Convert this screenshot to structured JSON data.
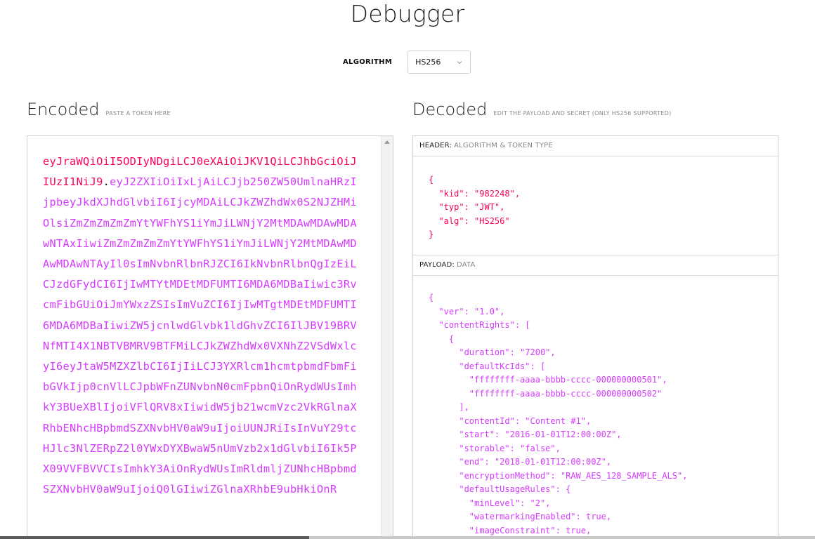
{
  "page": {
    "title": "Debugger"
  },
  "algorithm": {
    "label": "ALGORITHM",
    "value": "HS256"
  },
  "encoded": {
    "title": "Encoded",
    "subtitle": "PASTE A TOKEN HERE",
    "header_part": "eyJraWQiOiI5ODIyNDgiLCJ0eXAiOiJKV1QiLCJhbGciOiJIUzI1NiJ9",
    "dot": ".",
    "payload_part": "eyJ2ZXIiOiIxLjAiLCJjb250ZW50UmlnaHRzIjpbeyJkdXJhdGlvbiI6IjcyMDAiLCJkZWZhdWx0S2NJZHMiOlsiZmZmZmZmZmYtYWFhYS1iYmJiLWNjY2MtMDAwMDAwMDAwNTAxIiwiZmZmZmZmZmYtYWFhYS1iYmJiLWNjY2MtMDAwMDAwMDAwNTAyIl0sImNvbnRlbnRJZCI6IkNvbnRlbnQgIzEiLCJzdGFydCI6IjIwMTYtMDEtMDFUMTI6MDA6MDBaIiwic3RvcmFibGUiOiJmYWxzZSIsImVuZCI6IjIwMTgtMDEtMDFUMTI6MDA6MDBaIiwiZW5jcnlwdGlvbk1ldGhvZCI6IlJBV19BRVNfMTI4X1NBTVBMRV9BTFMiLCJkZWZhdWx0VXNhZ2VSdWxlcyI6eyJtaW5MZXZlbCI6IjIiLCJ3YXRlcm1hcmtpbmdFbmFibGVkIjp0cnVlLCJpbWFnZUNvbnN0cmFpbnQiOnRydWUsImhkY3BUeXBlIjoiVFlQRV8xIiwidW5jb21wcmVzc2VkRGlnaXRhbENhcHBpbmdSZXNvbHV0aW9uIjoiUUNJRiIsInVuY29tcHJlc3NlZERpZ2l0YWxDYXBwaW5nUmVzb2x1dGlvbiI6Ik5PX09VVFBVVCIsImhkY3AiOnRydWUsImRldmljZUNhcHBpbmdSZXNvbHV0aW9uIjoiQ0lGIiwiZGlnaXRhbE9ubHkiOnR"
  },
  "decoded": {
    "title": "Decoded",
    "subtitle": "EDIT THE PAYLOAD AND SECRET (ONLY HS256 SUPPORTED)",
    "header": {
      "label": "HEADER:",
      "sublabel": "ALGORITHM & TOKEN TYPE",
      "code": "{\n  \"kid\": \"982248\",\n  \"typ\": \"JWT\",\n  \"alg\": \"HS256\"\n}"
    },
    "payload": {
      "label": "PAYLOAD:",
      "sublabel": "DATA",
      "code": "{\n  \"ver\": \"1.0\",\n  \"contentRights\": [\n    {\n      \"duration\": \"7200\",\n      \"defaultKcIds\": [\n        \"ffffffff-aaaa-bbbb-cccc-000000000501\",\n        \"ffffffff-aaaa-bbbb-cccc-000000000502\"\n      ],\n      \"contentId\": \"Content #1\",\n      \"start\": \"2016-01-01T12:00:00Z\",\n      \"storable\": \"false\",\n      \"end\": \"2018-01-01T12:00:00Z\",\n      \"encryptionMethod\": \"RAW_AES_128_SAMPLE_ALS\",\n      \"defaultUsageRules\": {\n        \"minLevel\": \"2\",\n        \"watermarkingEnabled\": true,\n        \"imageConstraint\": true,"
    }
  }
}
